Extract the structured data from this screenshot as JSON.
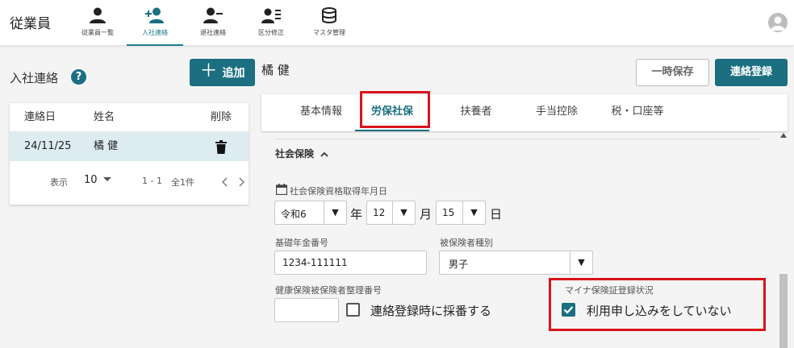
{
  "app": {
    "title": "従業員"
  },
  "nav": [
    {
      "label": "従業員一覧",
      "icon": "person-icon"
    },
    {
      "label": "入社連絡",
      "icon": "person-add-icon",
      "active": true
    },
    {
      "label": "退社連絡",
      "icon": "person-remove-icon"
    },
    {
      "label": "区分修正",
      "icon": "person-list-icon"
    },
    {
      "label": "マスタ管理",
      "icon": "database-icon"
    }
  ],
  "left_panel": {
    "title": "入社連絡",
    "help_glyph": "?",
    "add_button": {
      "plus": "＋",
      "label": "追加"
    },
    "columns": {
      "date": "連絡日",
      "name": "姓名",
      "delete": "削除"
    },
    "rows": [
      {
        "date": "24/11/25",
        "name": "橘 健"
      }
    ],
    "pager": {
      "per_page_label": "表示",
      "per_page": "10",
      "range": "1 - 1",
      "total": "全1件"
    }
  },
  "main": {
    "employee_name": "橘 健",
    "temp_save_label": "一時保存",
    "register_label": "連絡登録",
    "tabs": [
      "基本情報",
      "労保社保",
      "扶養者",
      "手当控除",
      "税・口座等"
    ],
    "active_tab": 1,
    "section_title": "社会保険",
    "acquisition_date": {
      "label": "社会保険資格取得年月日",
      "era": "令和6",
      "year_unit": "年",
      "month": "12",
      "month_unit": "月",
      "day": "15",
      "day_unit": "日"
    },
    "pension_number": {
      "label": "基礎年金番号",
      "value": "1234-111111"
    },
    "insured_type": {
      "label": "被保険者種別",
      "value": "男子"
    },
    "health_insurance_number": {
      "label": "健康保険被保険者整理番号",
      "value": "",
      "auto_number_label": "連絡登録時に採番する",
      "auto_number_checked": false
    },
    "my_number_insurance": {
      "label": "マイナ保険証登録状況",
      "option_label": "利用申し込みをしていない",
      "checked": true
    }
  },
  "colors": {
    "accent": "#1b6f80",
    "highlight": "#d8141c",
    "row_selected": "#ddecf0"
  }
}
